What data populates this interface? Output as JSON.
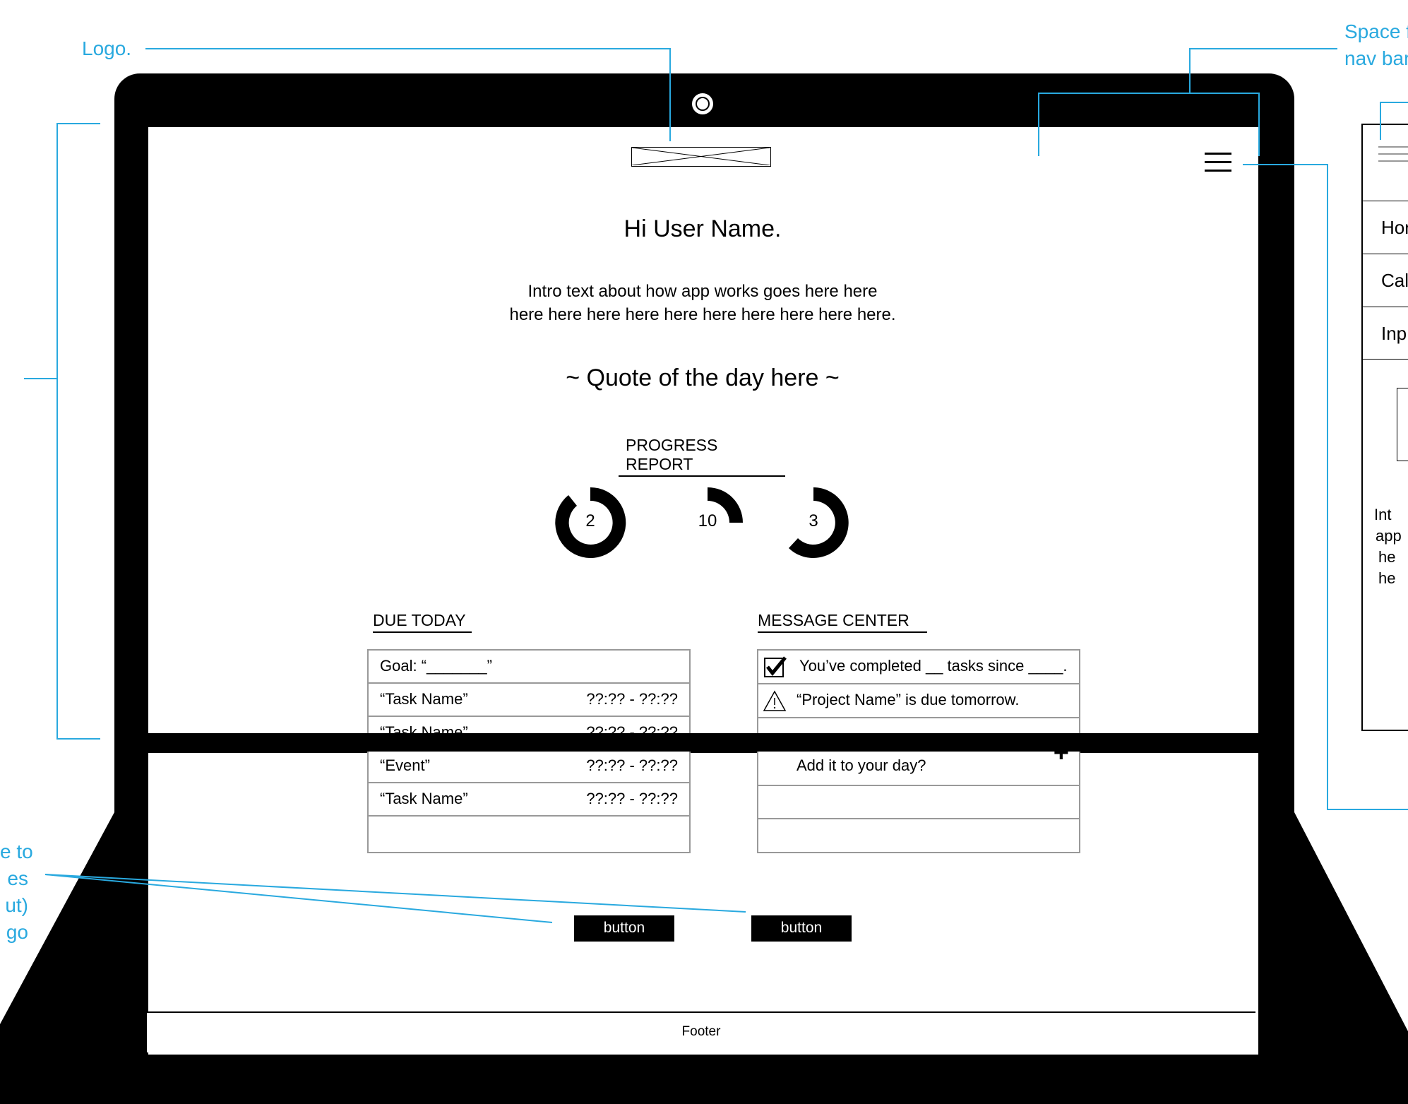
{
  "annotations": {
    "logo": "Logo.",
    "nav_space_line1": "Space f",
    "nav_space_line2": "nav bar",
    "buttons_line1": "e to",
    "buttons_line2": "es",
    "buttons_line3": "ut)",
    "buttons_line4": "go"
  },
  "main": {
    "greeting": "Hi User Name.",
    "intro_line1": "Intro text about how app works goes here here",
    "intro_line2": "here here here here here here here here here here.",
    "quote": "~ Quote of the day here ~",
    "progress_title": "PROGRESS REPORT",
    "progress_values": [
      "2",
      "10",
      "3"
    ]
  },
  "due_today": {
    "title": "DUE TODAY",
    "goal": "Goal: “_______”",
    "rows": [
      {
        "name": "“Task Name”",
        "time": "??:?? - ??:??"
      },
      {
        "name": "“Task Name”",
        "time": "??:?? - ??:??"
      },
      {
        "name": "“Event”",
        "time": "??:?? - ??:??"
      },
      {
        "name": "“Task Name”",
        "time": "??:?? - ??:??"
      }
    ]
  },
  "message_center": {
    "title": "MESSAGE CENTER",
    "messages": [
      "You’ve completed __ tasks since ____.",
      "“Project Name” is due tomorrow.",
      "Add it to your day?"
    ]
  },
  "buttons": [
    "button",
    "button"
  ],
  "footer": "Footer",
  "mobile_menu": {
    "items": [
      "Hor",
      "Cal",
      "Inp"
    ],
    "intro_lines": [
      "Int",
      "app",
      "he",
      "he"
    ]
  }
}
